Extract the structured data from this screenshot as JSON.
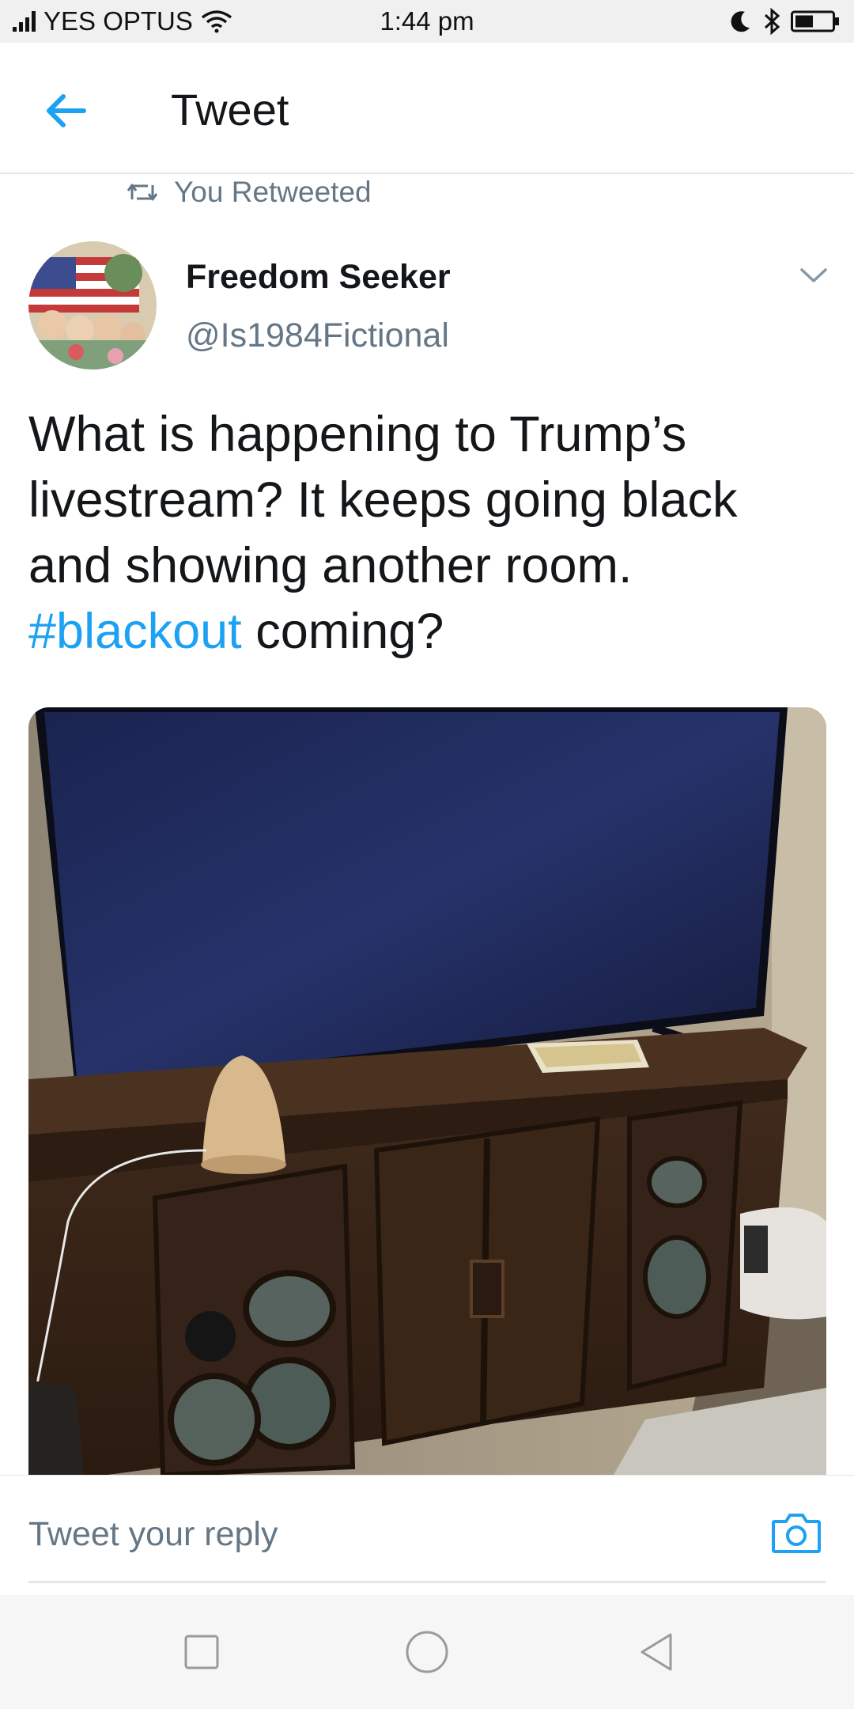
{
  "status_bar": {
    "carrier": "YES OPTUS",
    "time": "1:44 pm",
    "icons": [
      "signal-icon",
      "wifi-icon",
      "moon-icon",
      "bluetooth-icon",
      "battery-icon"
    ]
  },
  "header": {
    "title": "Tweet",
    "back_icon": "arrow-left-icon"
  },
  "tweet": {
    "retweet_label": "You Retweeted",
    "author_name": "Freedom Seeker",
    "author_handle": "@Is1984Fictional",
    "text_before_hashtag": "What is happening to Trump’s livestream? It keeps going black and showing another room. ",
    "hashtag": "#blackout",
    "text_after_hashtag": " coming?",
    "menu_icon": "chevron-down-icon"
  },
  "reply": {
    "placeholder": "Tweet your reply",
    "camera_icon": "camera-icon"
  },
  "navbar": {
    "icons": [
      "square-recent-icon",
      "circle-home-icon",
      "triangle-back-icon"
    ]
  },
  "colors": {
    "accent": "#1da1f2",
    "secondary_text": "#657786",
    "primary_text": "#14171a"
  }
}
